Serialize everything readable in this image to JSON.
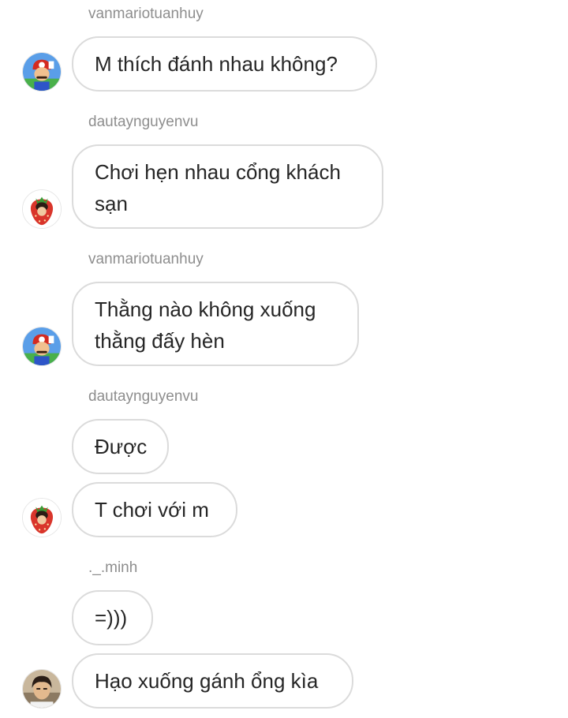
{
  "messages": [
    {
      "username": "vanmariotuanhuy",
      "bubbles": [
        {
          "lines": [
            "M thích đánh nhau không?"
          ]
        }
      ]
    },
    {
      "username": "dautaynguyenvu",
      "bubbles": [
        {
          "lines": [
            "Chơi hẹn nhau cổng khách",
            "sạn"
          ]
        }
      ]
    },
    {
      "username": "vanmariotuanhuy",
      "bubbles": [
        {
          "lines": [
            "Thằng nào không xuống",
            "thằng đấy hèn"
          ]
        }
      ]
    },
    {
      "username": "dautaynguyenvu",
      "bubbles": [
        {
          "lines": [
            "Được"
          ]
        },
        {
          "lines": [
            "T chơi với m"
          ]
        }
      ]
    },
    {
      "username": "._.minh",
      "bubbles": [
        {
          "lines": [
            "=)))"
          ]
        },
        {
          "lines": [
            "Hạo xuống gánh ổng kìa"
          ]
        }
      ]
    }
  ],
  "avatars": {
    "vanmariotuanhuy": "mario-avatar-icon",
    "dautaynguyenvu": "strawberry-avatar-icon",
    "minh": "person-photo-avatar-icon"
  },
  "colors": {
    "background": "#ffffff",
    "bubble_border": "#dbdbdb",
    "message_text": "#262626",
    "username_text": "#8e8e8e"
  }
}
